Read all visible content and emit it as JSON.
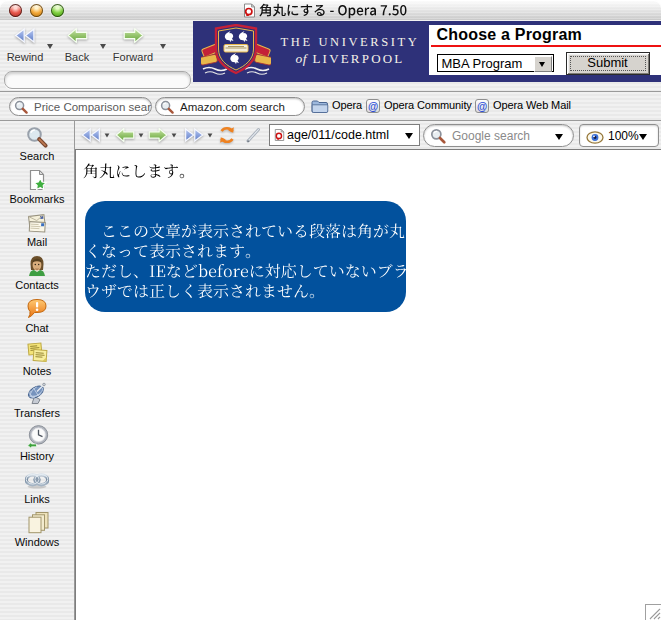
{
  "window": {
    "title": "角丸にする - Opera 7.50",
    "controls": [
      "close",
      "minimize",
      "zoom"
    ]
  },
  "toolbar": {
    "rewind_label": "Rewind",
    "back_label": "Back",
    "forward_label": "Forward"
  },
  "banner": {
    "university_line1": "THE UNIVERSITY",
    "university_of": "of",
    "university_line2": "LIVERPOOL",
    "heading": "Choose a Program",
    "program_value": "MBA Program",
    "submit_label": "Submit",
    "background_color": "#2e3179",
    "underline_color": "#ee1111"
  },
  "searchbar": {
    "price_search_placeholder": "Price Comparison sear",
    "amazon_search_placeholder": "Amazon.com search",
    "at_symbol": "@",
    "opera_label": "Opera",
    "community_label": "Opera Community",
    "webmail_label": "Opera Web Mail"
  },
  "addressbar": {
    "url_value": "age/011/code.html",
    "google_placeholder": "Google search",
    "zoom_value": "100%"
  },
  "sidebar": {
    "items": [
      {
        "label": "Search",
        "icon": "magnifier-icon"
      },
      {
        "label": "Bookmarks",
        "icon": "bookmark-star-icon"
      },
      {
        "label": "Mail",
        "icon": "envelopes-icon"
      },
      {
        "label": "Contacts",
        "icon": "person-icon"
      },
      {
        "label": "Chat",
        "icon": "speech-bubble-icon"
      },
      {
        "label": "Notes",
        "icon": "sticky-notes-icon"
      },
      {
        "label": "Transfers",
        "icon": "satellite-dish-icon"
      },
      {
        "label": "History",
        "icon": "clock-icon"
      },
      {
        "label": "Links",
        "icon": "chain-link-icon"
      },
      {
        "label": "Windows",
        "icon": "window-stack-icon"
      }
    ]
  },
  "content": {
    "heading": "角丸にします。",
    "paragraph": "　ここの文章が表示されている段落は角が丸くなって表示されます。\nただし、IEなどbeforeに対応していないブラウザでは正しく表示されません。",
    "lines": [
      "　ここの文章が表示されている段落は角が丸",
      "くなって表示されます。",
      "ただし、IEなどbeforeに対応していないブラ",
      "ウザでは正しく表示されません。"
    ],
    "box_color": "#02519d",
    "text_color": "#ffffff"
  }
}
